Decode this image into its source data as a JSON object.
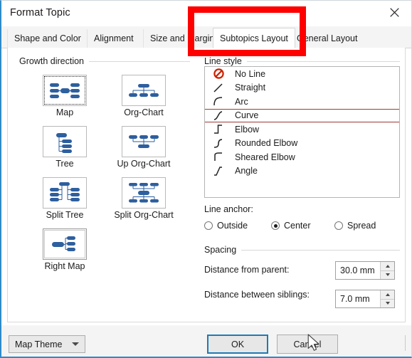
{
  "window": {
    "title": "Format Topic",
    "close_icon": "close-icon"
  },
  "tabs": [
    {
      "label": "Shape and Color",
      "active": false
    },
    {
      "label": "Alignment",
      "active": false
    },
    {
      "label": "Size and Margins",
      "active": false
    },
    {
      "label": "Subtopics Layout",
      "active": true
    },
    {
      "label": "General Layout",
      "active": false
    }
  ],
  "growth_direction": {
    "group_label": "Growth direction",
    "tiles": [
      {
        "label": "Map",
        "icon": "map-layout-icon",
        "state": "focused"
      },
      {
        "label": "Org-Chart",
        "icon": "org-chart-layout-icon",
        "state": "normal"
      },
      {
        "label": "Tree",
        "icon": "tree-layout-icon",
        "state": "normal"
      },
      {
        "label": "Up Org-Chart",
        "icon": "up-org-chart-layout-icon",
        "state": "normal"
      },
      {
        "label": "Split Tree",
        "icon": "split-tree-layout-icon",
        "state": "normal"
      },
      {
        "label": "Split Org-Chart",
        "icon": "split-org-chart-layout-icon",
        "state": "normal"
      },
      {
        "label": "Right Map",
        "icon": "right-map-layout-icon",
        "state": "selected"
      }
    ]
  },
  "line_style": {
    "group_label": "Line style",
    "items": [
      {
        "label": "No Line",
        "icon": "no-line-icon",
        "selected": false
      },
      {
        "label": "Straight",
        "icon": "straight-line-icon",
        "selected": false
      },
      {
        "label": "Arc",
        "icon": "arc-line-icon",
        "selected": false
      },
      {
        "label": "Curve",
        "icon": "curve-line-icon",
        "selected": true
      },
      {
        "label": "Elbow",
        "icon": "elbow-line-icon",
        "selected": false
      },
      {
        "label": "Rounded Elbow",
        "icon": "rounded-elbow-line-icon",
        "selected": false
      },
      {
        "label": "Sheared Elbow",
        "icon": "sheared-elbow-line-icon",
        "selected": false
      },
      {
        "label": "Angle",
        "icon": "angle-line-icon",
        "selected": false
      }
    ],
    "selection_border_color": "#9e3b36"
  },
  "line_anchor": {
    "label": "Line anchor:",
    "options": [
      {
        "label": "Outside",
        "checked": false
      },
      {
        "label": "Center",
        "checked": true
      },
      {
        "label": "Spread",
        "checked": false
      }
    ]
  },
  "spacing": {
    "group_label": "Spacing",
    "fields": [
      {
        "label": "Distance from parent:",
        "value": "30.0 mm"
      },
      {
        "label": "Distance between siblings:",
        "value": "7.0 mm"
      }
    ]
  },
  "footer": {
    "theme_button": "Map Theme",
    "ok_button": "OK",
    "cancel_button": "Cancel"
  },
  "annotation": {
    "type": "rectangle-highlight",
    "color": "#ff0000",
    "target": "Subtopics Layout"
  },
  "accent_colors": {
    "icon_blue": "#2e5f9e",
    "window_border_blue": "#2e8bc9",
    "focus_blue": "#2079b5"
  }
}
